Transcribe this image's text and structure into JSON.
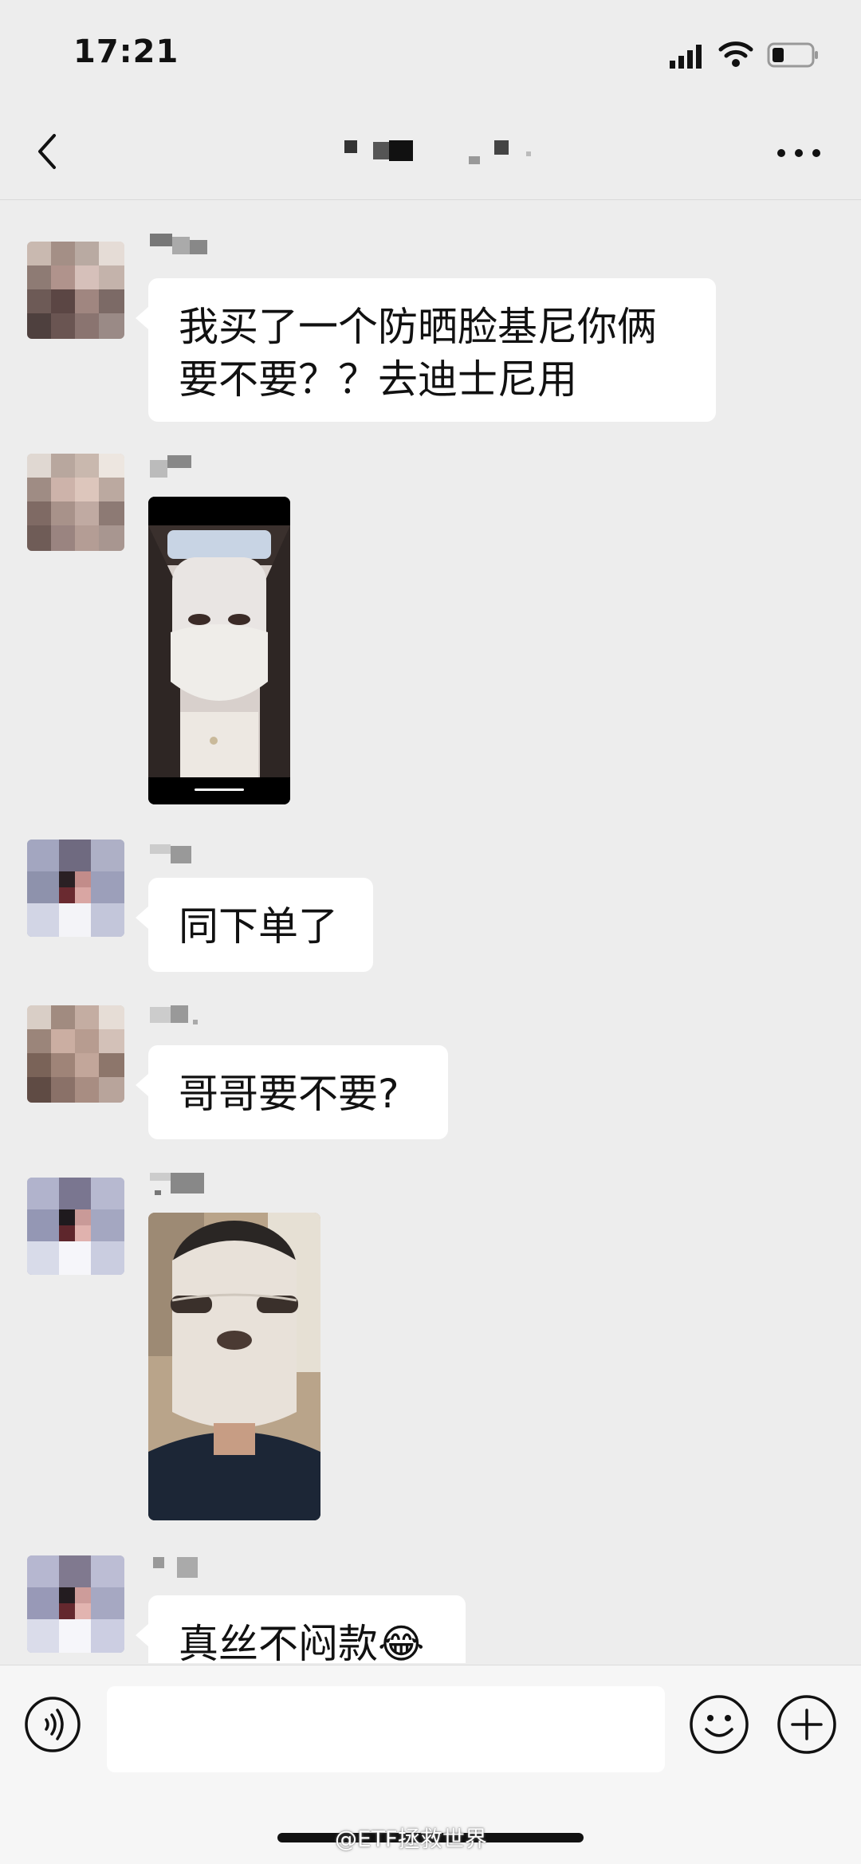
{
  "status_bar": {
    "time": "17:21",
    "icons": [
      "signal-icon",
      "wifi-icon",
      "battery-icon"
    ]
  },
  "nav": {
    "back_icon": "chevron-left-icon",
    "more_icon": "more-icon"
  },
  "messages": [
    {
      "type": "text",
      "text": "我买了一个防晒脸基尼你俩\n要不要？？去迪士尼用"
    },
    {
      "type": "image"
    },
    {
      "type": "text",
      "text": "同下单了"
    },
    {
      "type": "text",
      "text": "哥哥要不要?"
    },
    {
      "type": "image"
    },
    {
      "type": "text",
      "text": "真丝不闷款😂"
    }
  ],
  "input_bar": {
    "icons": [
      "voice-icon",
      "emoji-icon",
      "plus-icon"
    ]
  },
  "watermark": "@ETF拯救世界",
  "colors": {
    "background": "#ededed",
    "bubble": "#ffffff",
    "input_bar": "#f6f6f6"
  }
}
